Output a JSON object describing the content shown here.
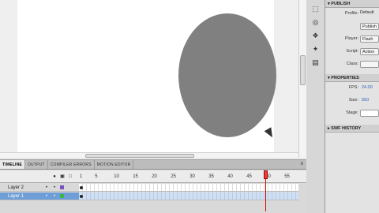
{
  "timeline": {
    "tabs": [
      "TIMELINE",
      "OUTPUT",
      "COMPILER ERRORS",
      "MOTION EDITOR"
    ],
    "menu_icon": "menu-icon",
    "frame_numbers": [
      "1",
      "5",
      "10",
      "15",
      "20",
      "25",
      "30",
      "35",
      "40",
      "45",
      "50",
      "55"
    ],
    "current_frame": 50,
    "layers": [
      {
        "name": "Layer 2",
        "color": "#7a4fc7",
        "selected": false
      },
      {
        "name": "Layer 1",
        "color": "#3ab54a",
        "selected": true
      }
    ]
  },
  "stage": {
    "shape": "ellipse",
    "shape_color": "#808080"
  },
  "tools": [
    "selection-icon",
    "3d-rotation-icon",
    "component-icon",
    "motion-presets-icon",
    "properties-icon"
  ],
  "properties": {
    "publish": {
      "title": "PUBLISH",
      "profile_label": "Profile:",
      "profile_value": "Default",
      "profile_button": "Publish",
      "player_label": "Player:",
      "player_value": "Flash",
      "script_label": "Script:",
      "script_value": "Action",
      "class_label": "Class:"
    },
    "props": {
      "title": "PROPERTIES",
      "fps_label": "FPS:",
      "fps_value": "24.00",
      "size_label": "Size:",
      "size_value": "550",
      "stage_label": "Stage:"
    },
    "swf_history": {
      "title": "SWF HISTORY"
    }
  }
}
